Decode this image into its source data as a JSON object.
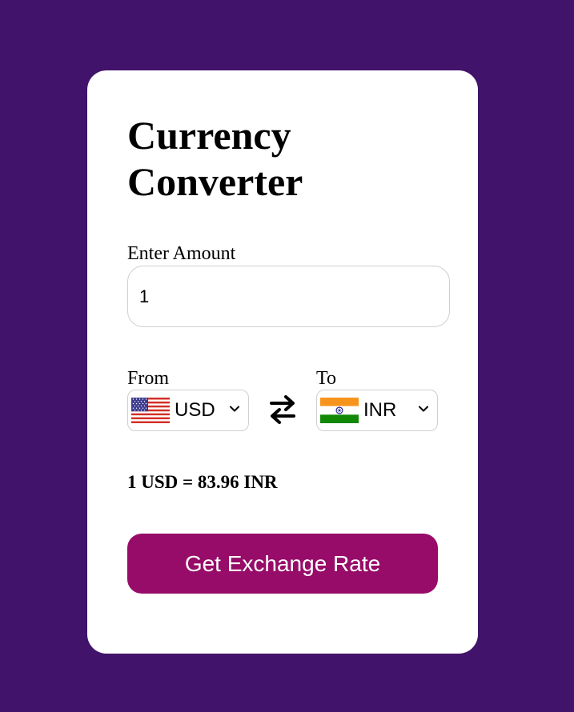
{
  "app": {
    "title": "Currency Converter"
  },
  "amount": {
    "label": "Enter Amount",
    "value": "1"
  },
  "from": {
    "label": "From",
    "currency": "USD",
    "flag_icon": "us-flag-icon"
  },
  "to": {
    "label": "To",
    "currency": "INR",
    "flag_icon": "india-flag-icon"
  },
  "swap_icon": "swap-arrows-icon",
  "result": {
    "text": "1 USD = 83.96 INR"
  },
  "button": {
    "label": "Get Exchange Rate"
  },
  "colors": {
    "background": "#41136b",
    "card": "#ffffff",
    "button": "#960c68",
    "button_text": "#ffffff"
  }
}
